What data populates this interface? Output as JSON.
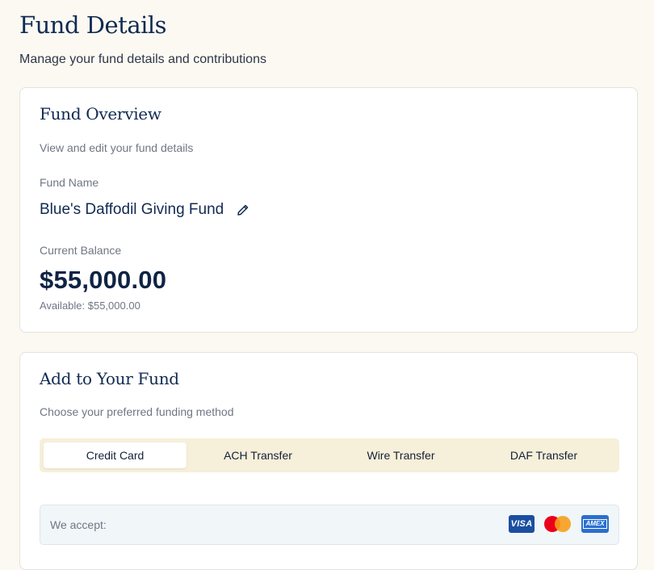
{
  "header": {
    "title": "Fund Details",
    "subtitle": "Manage your fund details and contributions"
  },
  "overview": {
    "title": "Fund Overview",
    "subtitle": "View and edit your fund details",
    "fund_name_label": "Fund Name",
    "fund_name": "Blue's Daffodil Giving Fund",
    "edit_icon": "pencil-icon",
    "balance_label": "Current Balance",
    "balance": "$55,000.00",
    "available": "Available: $55,000.00"
  },
  "add_fund": {
    "title": "Add to Your Fund",
    "subtitle": "Choose your preferred funding method",
    "tabs": [
      {
        "label": "Credit Card",
        "active": true
      },
      {
        "label": "ACH Transfer",
        "active": false
      },
      {
        "label": "Wire Transfer",
        "active": false
      },
      {
        "label": "DAF Transfer",
        "active": false
      }
    ],
    "accept_label": "We accept:",
    "card_brands": {
      "visa": "VISA",
      "mastercard": "mastercard-icon",
      "amex": "AMEX"
    }
  },
  "colors": {
    "background": "#fbf9f2",
    "navy": "#112a52",
    "tab_bar": "#f6efd9",
    "accept_box": "#f1f6f9"
  }
}
